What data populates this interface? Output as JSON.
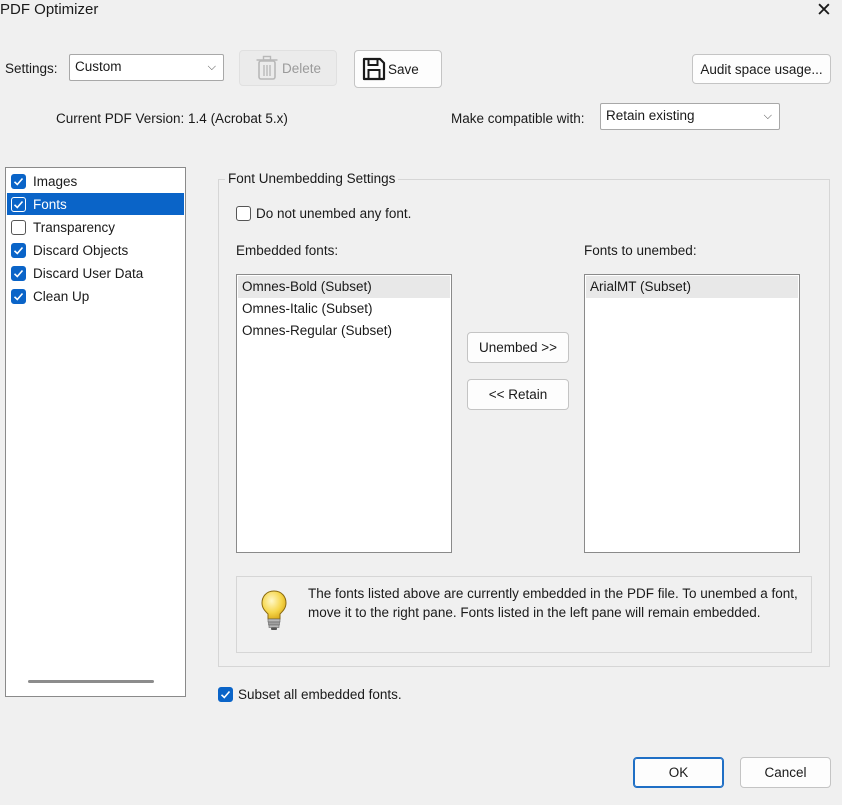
{
  "window": {
    "title": "PDF Optimizer"
  },
  "header": {
    "settings_label": "Settings:",
    "settings_value": "Custom",
    "delete_label": "Delete",
    "save_label": "Save",
    "audit_label": "Audit space usage...",
    "pdf_version": "Current PDF Version: 1.4 (Acrobat 5.x)",
    "compat_label": "Make compatible with:",
    "compat_value": "Retain existing"
  },
  "sidebar": {
    "items": [
      {
        "label": "Images",
        "checked": true,
        "selected": false
      },
      {
        "label": "Fonts",
        "checked": true,
        "selected": true
      },
      {
        "label": "Transparency",
        "checked": false,
        "selected": false
      },
      {
        "label": "Discard Objects",
        "checked": true,
        "selected": false
      },
      {
        "label": "Discard User Data",
        "checked": true,
        "selected": false
      },
      {
        "label": "Clean Up",
        "checked": true,
        "selected": false
      }
    ]
  },
  "fonts": {
    "group_title": "Font Unembedding Settings",
    "no_unembed_label": "Do not unembed any font.",
    "no_unembed_checked": false,
    "embedded_label": "Embedded fonts:",
    "embedded": [
      "Omnes-Bold (Subset)",
      "Omnes-Italic (Subset)",
      "Omnes-Regular (Subset)"
    ],
    "unembed_label": "Fonts to unembed:",
    "unembed": [
      "ArialMT (Subset)"
    ],
    "unembed_button": "Unembed >>",
    "retain_button": "<< Retain",
    "info_line1": "The fonts listed above are currently embedded in the PDF file. To unembed a font,",
    "info_line2": "move it to the right pane. Fonts listed in the left pane will remain embedded.",
    "subset_label": "Subset all embedded fonts.",
    "subset_checked": true
  },
  "footer": {
    "ok_label": "OK",
    "cancel_label": "Cancel"
  }
}
